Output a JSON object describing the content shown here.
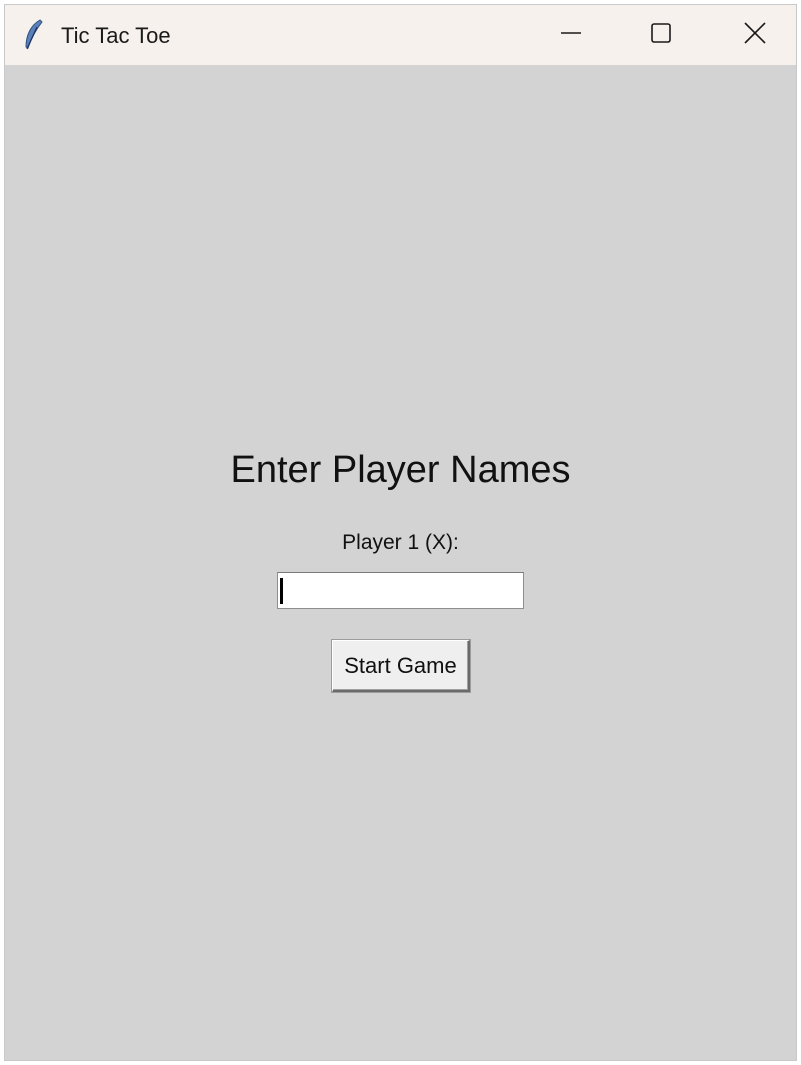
{
  "window": {
    "title": "Tic Tac Toe",
    "icon": "feather-icon",
    "controls": {
      "minimize": "minimize-icon",
      "maximize": "maximize-icon",
      "close": "close-icon"
    }
  },
  "form": {
    "heading": "Enter Player Names",
    "player1_label": "Player 1 (X):",
    "player1_value": "",
    "start_button_label": "Start Game"
  },
  "colors": {
    "titlebar_bg": "#f6f1ec",
    "content_bg": "#d3d3d3",
    "input_bg": "#ffffff",
    "button_bg": "#efefef"
  }
}
